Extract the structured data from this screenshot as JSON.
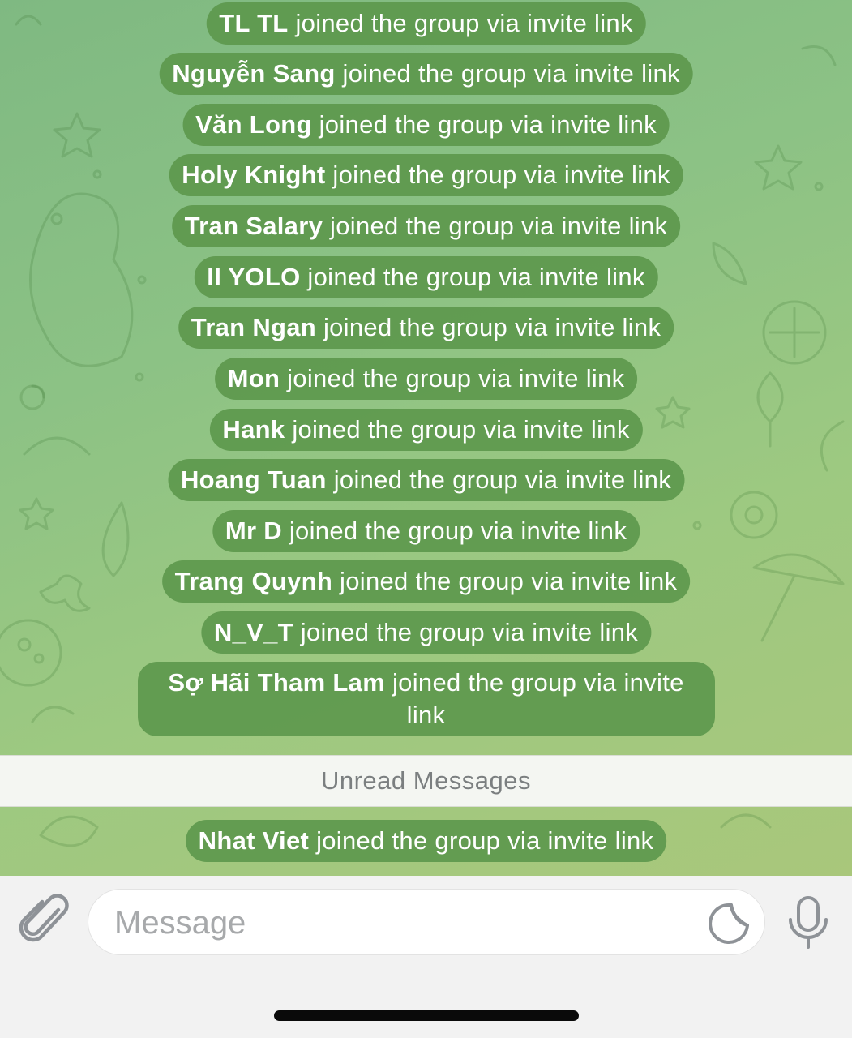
{
  "chat": {
    "messages": [
      {
        "name": "TL TL",
        "text": "joined the group via invite link"
      },
      {
        "name": "Nguyễn Sang",
        "text": "joined the group via invite link"
      },
      {
        "name": "Văn Long",
        "text": "joined the group via invite link"
      },
      {
        "name": "Holy Knight",
        "text": "joined the group via invite link"
      },
      {
        "name": "Tran Salary",
        "text": "joined the group via invite link"
      },
      {
        "name": "II YOLO",
        "text": "joined the group via invite link"
      },
      {
        "name": "Tran Ngan",
        "text": "joined the group via invite link"
      },
      {
        "name": "Mon",
        "text": "joined the group via invite link"
      },
      {
        "name": "Hank",
        "text": "joined the group via invite link"
      },
      {
        "name": "Hoang Tuan",
        "text": "joined the group via invite link"
      },
      {
        "name": "Mr D",
        "text": "joined the group via invite link"
      },
      {
        "name": "Trang Quynh",
        "text": "joined the group via invite link"
      },
      {
        "name": "N_V_T",
        "text": "joined the group via invite link"
      },
      {
        "name": "Sợ Hãi Tham Lam",
        "text": "joined the group via invite link"
      }
    ],
    "unread_label": "Unread Messages",
    "after_unread": [
      {
        "name": "Nhat Viet",
        "text": "joined the group via invite link"
      }
    ]
  },
  "composer": {
    "placeholder": "Message",
    "attach_icon": "paperclip-icon",
    "sticker_icon": "sticker-icon",
    "mic_icon": "microphone-icon"
  },
  "colors": {
    "wallpaper": "#8cc285",
    "service_bubble": "#5d984d",
    "unread_bar": "#f4f6f2"
  }
}
